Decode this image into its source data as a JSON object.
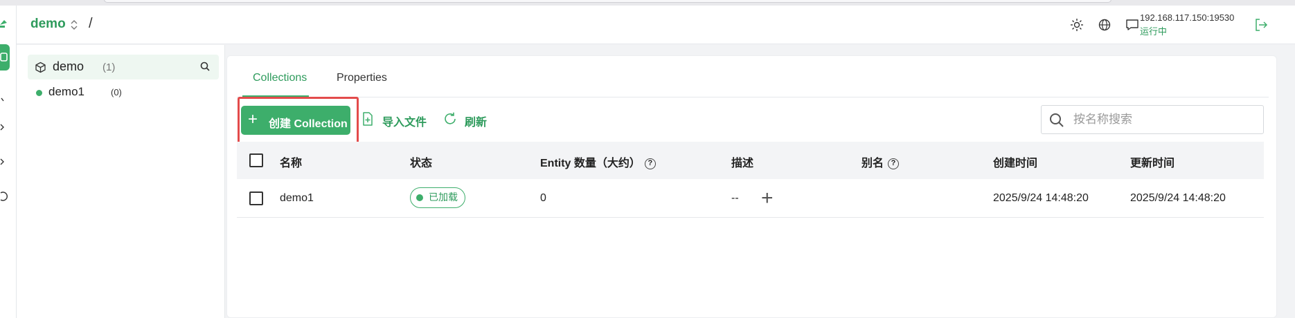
{
  "header": {
    "db_name": "demo",
    "separator": "/",
    "server_address": "192.168.117.150:19530",
    "server_status": "运行中"
  },
  "tree": {
    "database": {
      "name": "demo",
      "count": "(1)"
    },
    "collections": [
      {
        "name": "demo1",
        "count": "(0)"
      }
    ]
  },
  "tabs": [
    {
      "label": "Collections"
    },
    {
      "label": "Properties"
    }
  ],
  "toolbar": {
    "create_label": "创建 Collection",
    "import_label": "导入文件",
    "refresh_label": "刷新"
  },
  "search": {
    "placeholder": "按名称搜索"
  },
  "table": {
    "headers": {
      "name": "名称",
      "status": "状态",
      "entity": "Entity 数量（大约）",
      "description": "描述",
      "alias": "别名",
      "created": "创建时间",
      "updated": "更新时间"
    },
    "rows": [
      {
        "name": "demo1",
        "status": "已加载",
        "entity": "0",
        "description": "--",
        "alias": "+",
        "created": "2025/9/24 14:48:20",
        "updated": "2025/9/24 14:48:20"
      }
    ]
  },
  "colors": {
    "accent": "#3dae6b",
    "accent_text": "#2e9b5c",
    "highlight": "#e34b4b"
  },
  "icons": [
    "logo-icon",
    "database-icon",
    "chevron-up-down-icon",
    "sun-icon",
    "globe-icon",
    "message-icon",
    "logout-icon",
    "cube-icon",
    "search-icon",
    "plus-icon",
    "file-import-icon",
    "refresh-icon",
    "help-icon"
  ]
}
